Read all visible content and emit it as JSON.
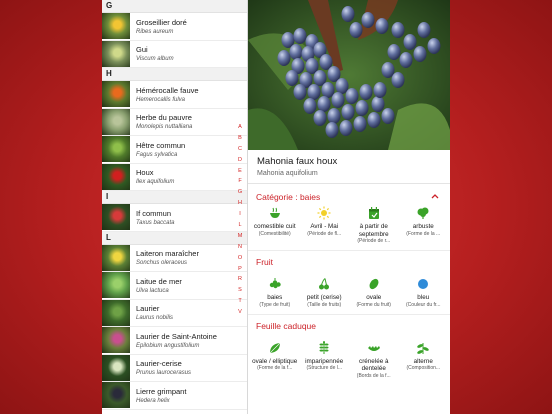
{
  "list": {
    "sections": [
      {
        "letter": "G",
        "items": [
          {
            "name": "Groseillier doré",
            "latin": "Ribes aureum",
            "thumb_color": "#6e8d3a",
            "accent": "#f2c533"
          },
          {
            "name": "Gui",
            "latin": "Viscum album",
            "thumb_color": "#7a8f5a",
            "accent": "#cfd98a"
          }
        ]
      },
      {
        "letter": "H",
        "items": [
          {
            "name": "Hémérocalle fauve",
            "latin": "Hemerocallis fulva",
            "thumb_color": "#5d7a2e",
            "accent": "#e96a1d"
          },
          {
            "name": "Herbe du pauvre",
            "latin": "Monolepis nuttalliana",
            "thumb_color": "#8aa070",
            "accent": "#b8c49a"
          },
          {
            "name": "Hêtre commun",
            "latin": "Fagus sylvatica",
            "thumb_color": "#4f7a2a",
            "accent": "#8fbf4a"
          },
          {
            "name": "Houx",
            "latin": "Ilex aquifolium",
            "thumb_color": "#2f5a22",
            "accent": "#d11f1f"
          }
        ]
      },
      {
        "letter": "I",
        "items": [
          {
            "name": "If commun",
            "latin": "Taxus baccata",
            "thumb_color": "#2e4f23",
            "accent": "#d73a3a"
          }
        ]
      },
      {
        "letter": "L",
        "items": [
          {
            "name": "Laiteron maraîcher",
            "latin": "Sonchus oleraceus",
            "thumb_color": "#5b8035",
            "accent": "#f0d640"
          },
          {
            "name": "Laitue de mer",
            "latin": "Ulva lactuca",
            "thumb_color": "#5fa04a",
            "accent": "#9ad06a"
          },
          {
            "name": "Laurier",
            "latin": "Laurus nobilis",
            "thumb_color": "#3d6a2a",
            "accent": "#6ea146"
          },
          {
            "name": "Laurier de Saint-Antoine",
            "latin": "Epilobium angustifolium",
            "thumb_color": "#6a7f3c",
            "accent": "#c94f8f"
          },
          {
            "name": "Laurier-cerise",
            "latin": "Prunus laurocerasus",
            "thumb_color": "#2b4f22",
            "accent": "#d9e6c0"
          },
          {
            "name": "Lierre grimpant",
            "latin": "Hedera helix",
            "thumb_color": "#3b5a2a",
            "accent": "#2a2a3a"
          }
        ]
      }
    ],
    "index_letters": [
      "A",
      "B",
      "C",
      "D",
      "E",
      "F",
      "G",
      "H",
      "I",
      "L",
      "M",
      "N",
      "O",
      "P",
      "R",
      "S",
      "T",
      "V"
    ],
    "accent_color": "#d32222"
  },
  "detail": {
    "title": "Mahonia faux houx",
    "latin": "Mahonia aquifolium",
    "category": {
      "title": "Catégorie : baies",
      "items": [
        {
          "icon": "bowl-icon",
          "value": "comestible cuit",
          "label": "(Comestibilité)"
        },
        {
          "icon": "sun-icon",
          "value": "Avril - Mai",
          "label": "(Période de fl..."
        },
        {
          "icon": "calendar-icon",
          "value": "à partir de septembre",
          "label": "(Période de r..."
        },
        {
          "icon": "shrub-icon",
          "value": "arbuste",
          "label": "(Forme de la ..."
        }
      ]
    },
    "fruit": {
      "title": "Fruit",
      "items": [
        {
          "icon": "berries-icon",
          "value": "baies",
          "label": "(Type de fruit)"
        },
        {
          "icon": "cherry-icon",
          "value": "petit (cerise)",
          "label": "(Taille de fruits)"
        },
        {
          "icon": "oval-icon",
          "value": "ovale",
          "label": "(Forme du fruit)"
        },
        {
          "icon": "blue-dot-icon",
          "value": "bleu",
          "label": "(Couleur du fr..."
        }
      ]
    },
    "leaf": {
      "title": "Feuille caduque",
      "items": [
        {
          "icon": "leaf-oval-icon",
          "value": "ovale / elliptique",
          "label": "(Forme de la f..."
        },
        {
          "icon": "pinnate-leaf-icon",
          "value": "imparipennée",
          "label": "(Structure de l..."
        },
        {
          "icon": "serrated-leaf-icon",
          "value": "crénelée à dentelée",
          "label": "(Bords de la f..."
        },
        {
          "icon": "alternate-leaf-icon",
          "value": "alterne",
          "label": "(Composition..."
        }
      ]
    },
    "colors": {
      "accent": "#cc2229",
      "icon_green": "#3aa329",
      "icon_yellow": "#f2d02a",
      "icon_blue": "#2f8bd8"
    }
  }
}
